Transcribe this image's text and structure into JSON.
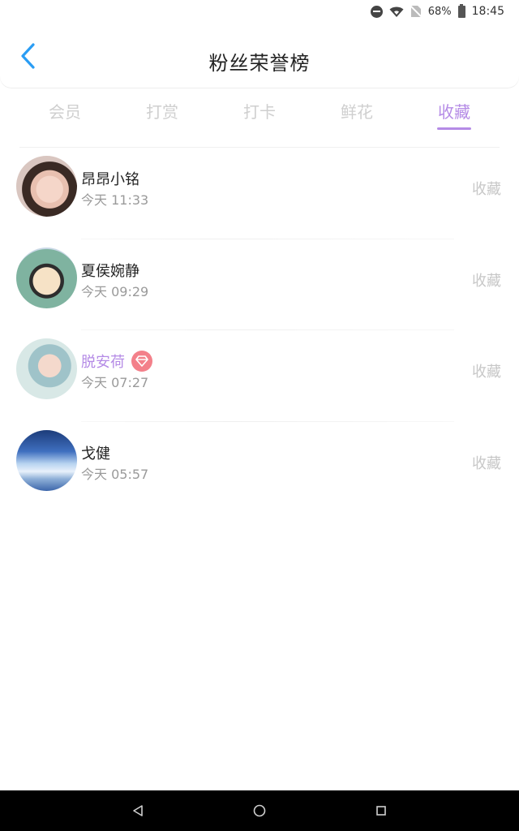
{
  "status_bar": {
    "battery": "68%",
    "time": "18:45"
  },
  "header": {
    "title": "粉丝荣誉榜"
  },
  "tabs": [
    {
      "label": "会员",
      "active": false
    },
    {
      "label": "打赏",
      "active": false
    },
    {
      "label": "打卡",
      "active": false
    },
    {
      "label": "鲜花",
      "active": false
    },
    {
      "label": "收藏",
      "active": true
    }
  ],
  "list": [
    {
      "name": "昂昂小铭",
      "time": "今天 11:33",
      "action": "收藏",
      "vip": false
    },
    {
      "name": "夏侯婉静",
      "time": "今天 09:29",
      "action": "收藏",
      "vip": false
    },
    {
      "name": "脱安荷",
      "time": "今天 07:27",
      "action": "收藏",
      "vip": true
    },
    {
      "name": "戈健",
      "time": "今天 05:57",
      "action": "收藏",
      "vip": false
    }
  ],
  "colors": {
    "accent": "#b58be6",
    "badge": "#f3808a",
    "back": "#2a9df4"
  }
}
